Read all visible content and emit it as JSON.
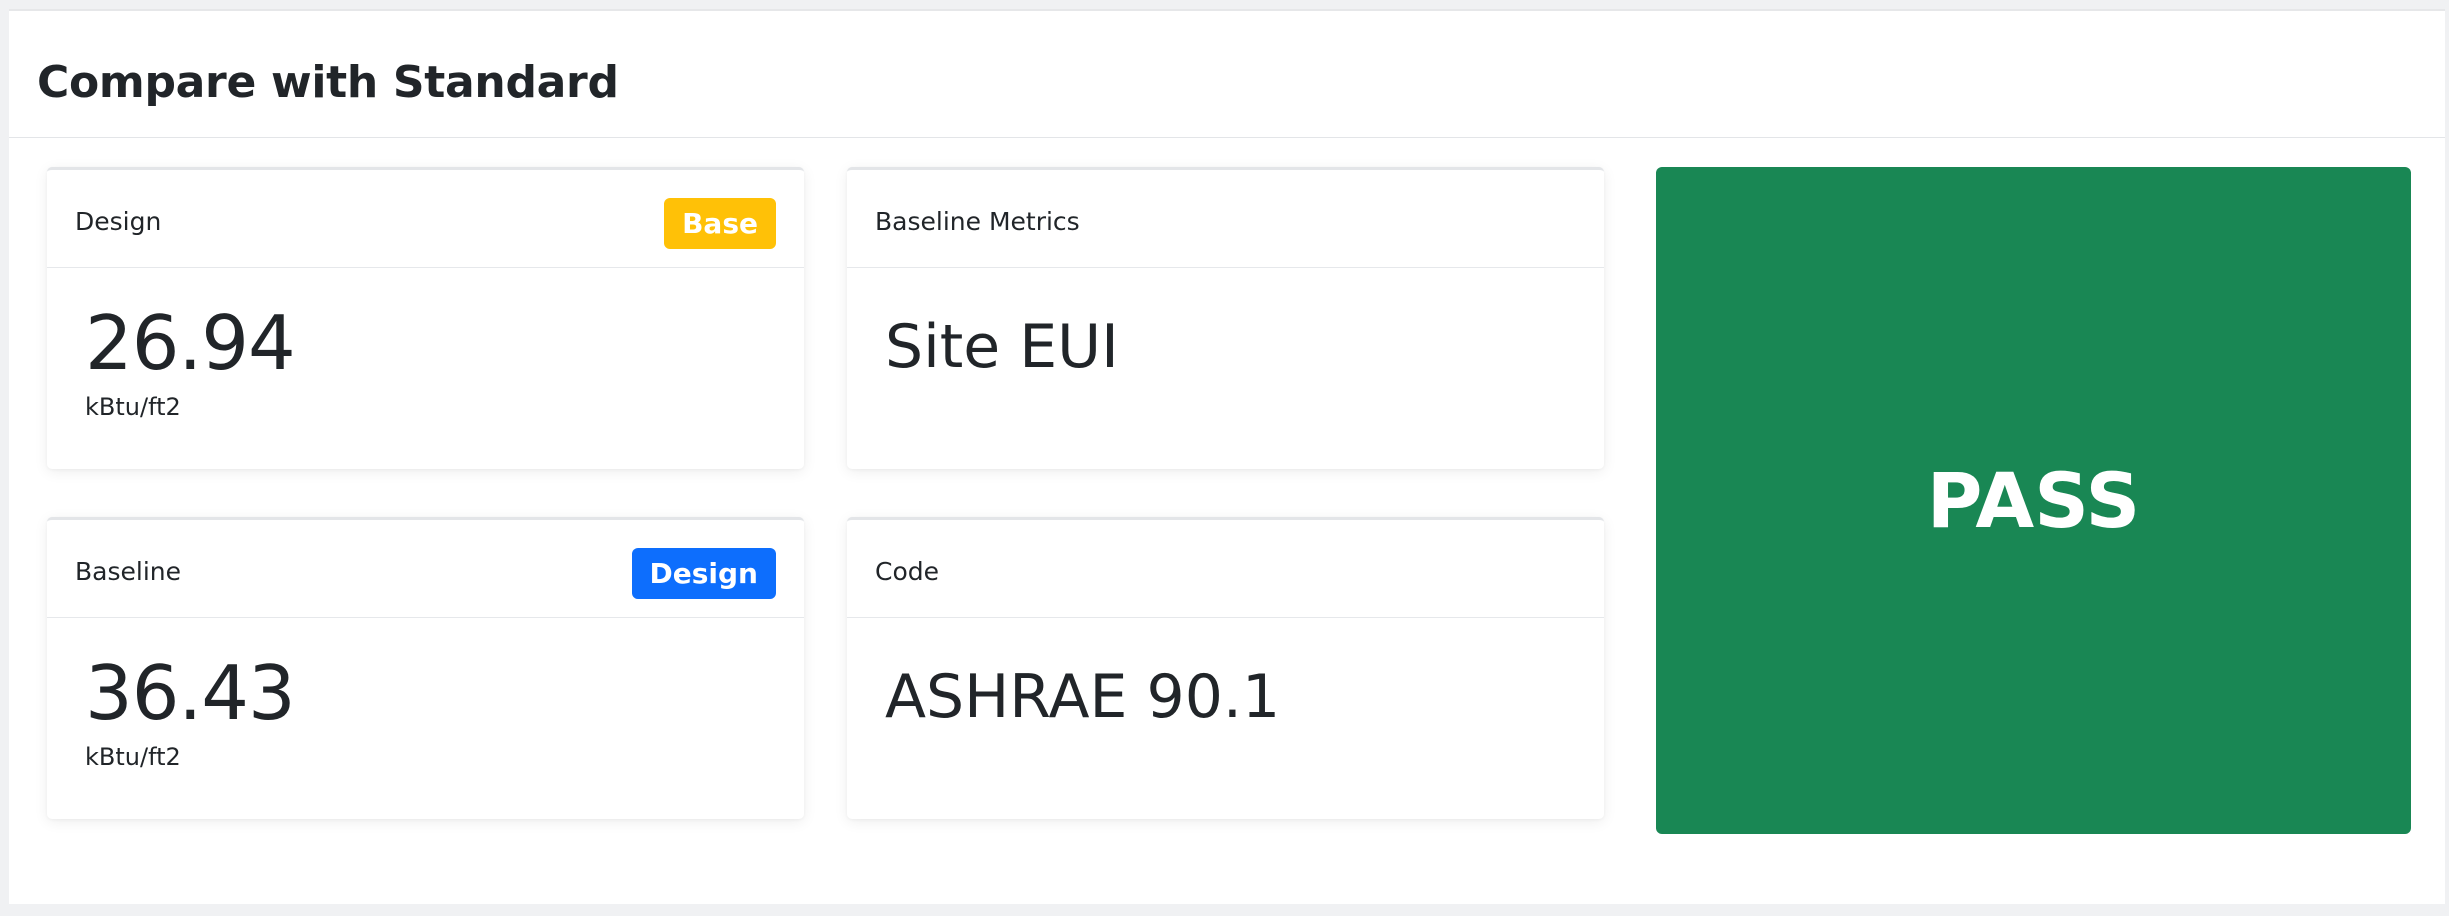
{
  "panel": {
    "title": "Compare with Standard"
  },
  "cards": {
    "design": {
      "label": "Design",
      "badge": "Base",
      "value": "26.94",
      "unit": "kBtu/ft2"
    },
    "baseline": {
      "label": "Baseline",
      "badge": "Design",
      "value": "36.43",
      "unit": "kBtu/ft2"
    },
    "baseline_metrics": {
      "label": "Baseline Metrics",
      "value": "Site EUI"
    },
    "code": {
      "label": "Code",
      "value": "ASHRAE 90.1"
    }
  },
  "result": {
    "text": "PASS",
    "color": "#198754"
  },
  "colors": {
    "badge_base": "#ffc107",
    "badge_design": "#0d6efd"
  }
}
